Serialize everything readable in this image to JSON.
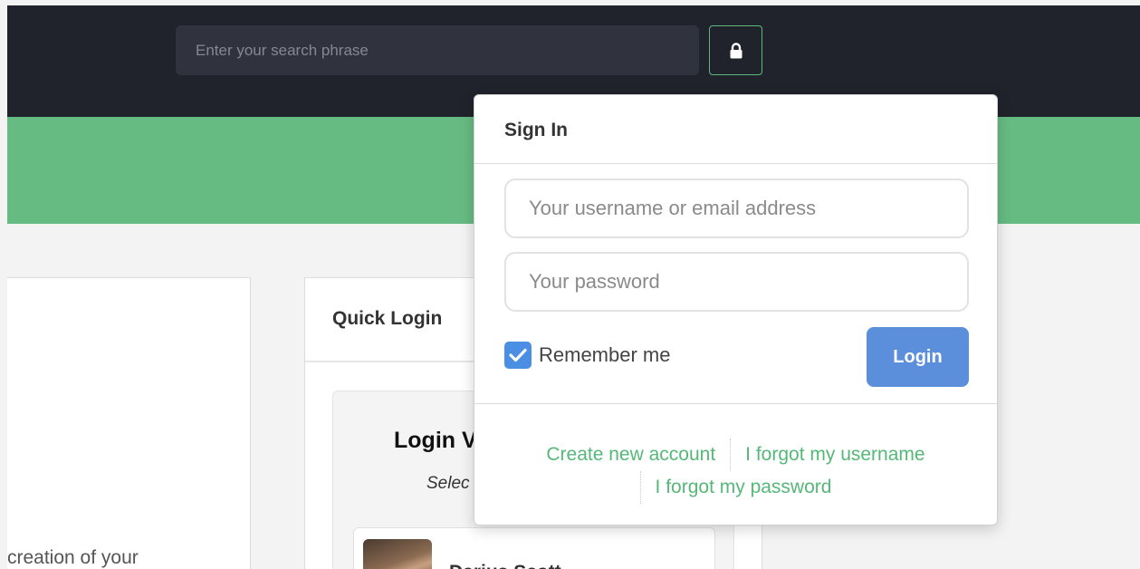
{
  "header": {
    "search_placeholder": "Enter your search phrase",
    "lock_icon": "lock-icon",
    "background_color": "#20232b",
    "accent_color": "#5fb97e"
  },
  "banner": {
    "color": "#66bb83"
  },
  "left_card": {
    "text": "creation of your"
  },
  "quick_login": {
    "title": "Quick Login",
    "heading": "Login V",
    "subheading": "Selec",
    "user": {
      "name": "Darius Scott"
    }
  },
  "signin": {
    "title": "Sign In",
    "username_placeholder": "Your username or email address",
    "password_placeholder": "Your password",
    "remember_label": "Remember me",
    "remember_checked": true,
    "login_label": "Login",
    "links": {
      "create_account": "Create new account",
      "forgot_username": "I forgot my username",
      "forgot_password": "I forgot my password"
    },
    "link_color": "#55b878",
    "button_color": "#5b8fdc"
  }
}
